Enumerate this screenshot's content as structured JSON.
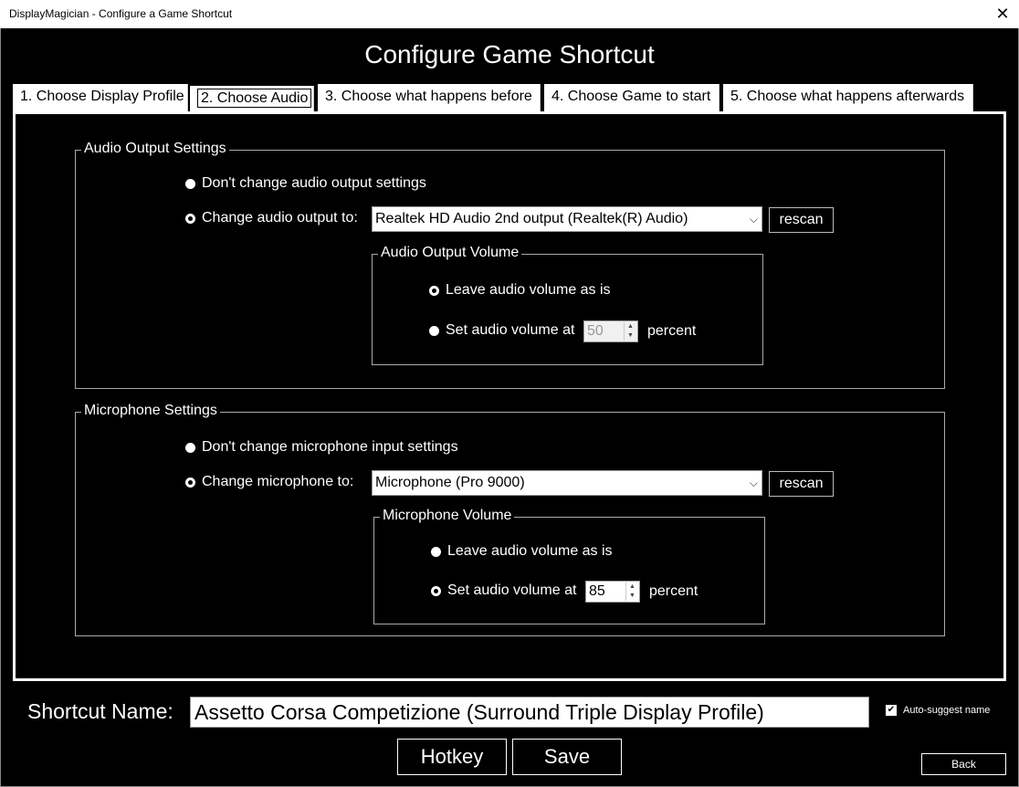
{
  "window": {
    "title": "DisplayMagician - Configure a Game Shortcut",
    "close_glyph": "✕"
  },
  "heading": "Configure Game Shortcut",
  "tabs": [
    {
      "label": "1. Choose Display Profile"
    },
    {
      "label": "2. Choose Audio"
    },
    {
      "label": "3. Choose what happens before"
    },
    {
      "label": "4. Choose Game to start"
    },
    {
      "label": "5. Choose what happens afterwards"
    }
  ],
  "audio": {
    "legend": "Audio Output Settings",
    "no_change_label": "Don't change audio output settings",
    "change_label": "Change audio output to:",
    "device": "Realtek HD Audio 2nd output (Realtek(R) Audio)",
    "rescan_label": "rescan",
    "volume_group": {
      "legend": "Audio Output Volume",
      "leave_label": "Leave audio volume as is",
      "set_label": "Set audio volume at",
      "value": "50",
      "unit": "percent"
    }
  },
  "mic": {
    "legend": "Microphone Settings",
    "no_change_label": "Don't change microphone input settings",
    "change_label": "Change microphone to:",
    "device": "Microphone (Pro 9000)",
    "rescan_label": "rescan",
    "volume_group": {
      "legend": "Microphone Volume",
      "leave_label": "Leave audio volume as is",
      "set_label": "Set audio volume at",
      "value": "85",
      "unit": "percent"
    }
  },
  "shortcut": {
    "label": "Shortcut Name:",
    "value": "Assetto Corsa Competizione (Surround Triple Display Profile)",
    "auto_suggest_label": "Auto-suggest name",
    "auto_suggest_checked": "✔"
  },
  "buttons": {
    "hotkey": "Hotkey",
    "save": "Save",
    "back": "Back"
  },
  "icons": {
    "dropdown": "⌵",
    "spin_up": "▲",
    "spin_down": "▼"
  }
}
